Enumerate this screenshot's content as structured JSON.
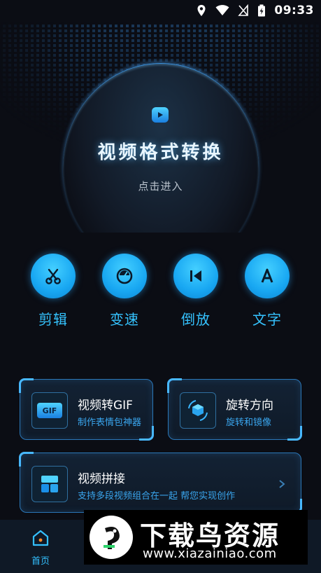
{
  "status_bar": {
    "time": "09:33"
  },
  "hero": {
    "title": "视频格式转换",
    "subtitle": "点击进入"
  },
  "tools": [
    {
      "label": "剪辑",
      "icon": "scissors-icon"
    },
    {
      "label": "变速",
      "icon": "speedometer-icon"
    },
    {
      "label": "倒放",
      "icon": "rewind-icon"
    },
    {
      "label": "文字",
      "icon": "text-icon"
    }
  ],
  "cards": {
    "gif": {
      "title": "视频转GIF",
      "desc": "制作表情包神器",
      "icon_text": "GIF"
    },
    "rotate": {
      "title": "旋转方向",
      "desc": "旋转和镜像"
    },
    "merge": {
      "title": "视频拼接",
      "desc": "支持多段视频组合在一起 帮您实现创作"
    }
  },
  "bottom_nav": {
    "home_label": "首页"
  },
  "watermark": {
    "title": "下载鸟资源",
    "url": "www.xiazainiao.com"
  },
  "colors": {
    "accent": "#35c3ff",
    "background": "#0b0d14",
    "card_border": "#2b77b8"
  }
}
